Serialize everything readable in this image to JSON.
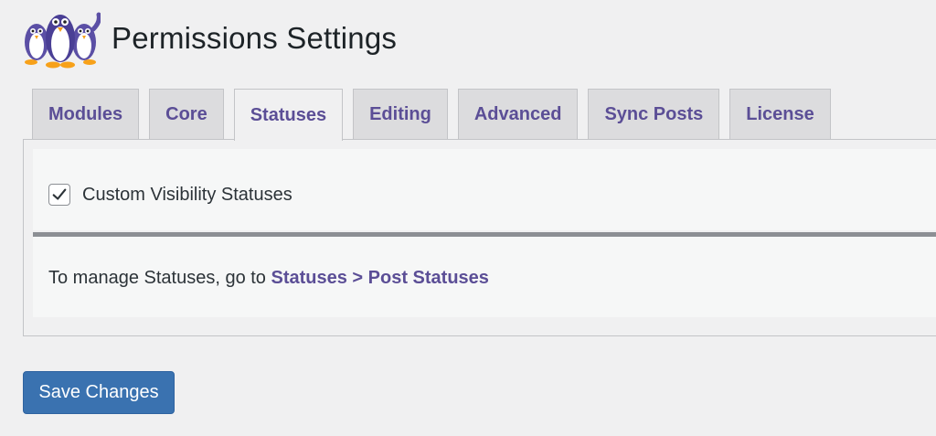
{
  "header": {
    "title": "Permissions Settings",
    "logo_icon": "penguins-logo-icon"
  },
  "tabs": [
    {
      "label": "Modules",
      "active": false
    },
    {
      "label": "Core",
      "active": false
    },
    {
      "label": "Statuses",
      "active": true
    },
    {
      "label": "Editing",
      "active": false
    },
    {
      "label": "Advanced",
      "active": false
    },
    {
      "label": "Sync Posts",
      "active": false
    },
    {
      "label": "License",
      "active": false
    }
  ],
  "settings": {
    "custom_visibility_label": "Custom Visibility Statuses",
    "custom_visibility_checked": true,
    "manage_text": "To manage Statuses, go to",
    "manage_link": "Statuses > Post Statuses"
  },
  "actions": {
    "save_label": "Save Changes"
  },
  "colors": {
    "accent": "#5b4e96",
    "button": "#3a72b0"
  }
}
